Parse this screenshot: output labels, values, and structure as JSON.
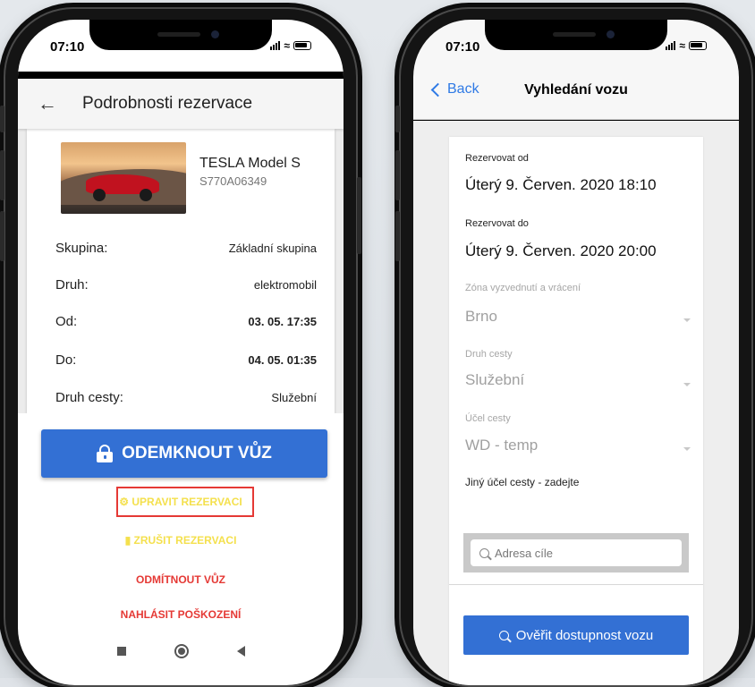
{
  "left": {
    "status_time": "07:10",
    "title": "Podrobnosti rezervace",
    "car": {
      "name": "TESLA Model S",
      "plate": "S770A06349"
    },
    "rows": [
      {
        "key": "Skupina:",
        "value": "Základní skupina"
      },
      {
        "key": "Druh:",
        "value": "elektromobil"
      },
      {
        "key": "Od:",
        "value": "03. 05. 17:35"
      },
      {
        "key": "Do:",
        "value": "04. 05. 01:35"
      },
      {
        "key": "Druh cesty:",
        "value": "Služební"
      }
    ],
    "unlock_label": "ODEMKNOUT VŮZ",
    "edit_label": "UPRAVIT REZERVACI",
    "cancel_label": "ZRUŠIT REZERVACI",
    "reject_label": "ODMÍTNOUT VŮZ",
    "report_label": "NAHLÁSIT POŠKOZENÍ"
  },
  "right": {
    "status_time": "07:10",
    "back_label": "Back",
    "title": "Vyhledání vozu",
    "from_label": "Rezervovat od",
    "from_value": "Úterý 9. Červen. 2020 18:10",
    "to_label": "Rezervovat do",
    "to_value": "Úterý 9. Červen. 2020 20:00",
    "zone_label": "Zóna vyzvednutí a vrácení",
    "zone_value": "Brno",
    "trip_type_label": "Druh cesty",
    "trip_type_value": "Služební",
    "purpose_label": "Účel cesty",
    "purpose_value": "WD - temp",
    "other_purpose_label": "Jiný účel cesty - zadejte",
    "address_placeholder": "Adresa cíle",
    "verify_label": "Ověřit dostupnost vozu"
  },
  "colors": {
    "primary": "#3370d4",
    "highlight": "#e53935",
    "yellow": "#f4e04d",
    "ios_blue": "#2f7ae5"
  }
}
